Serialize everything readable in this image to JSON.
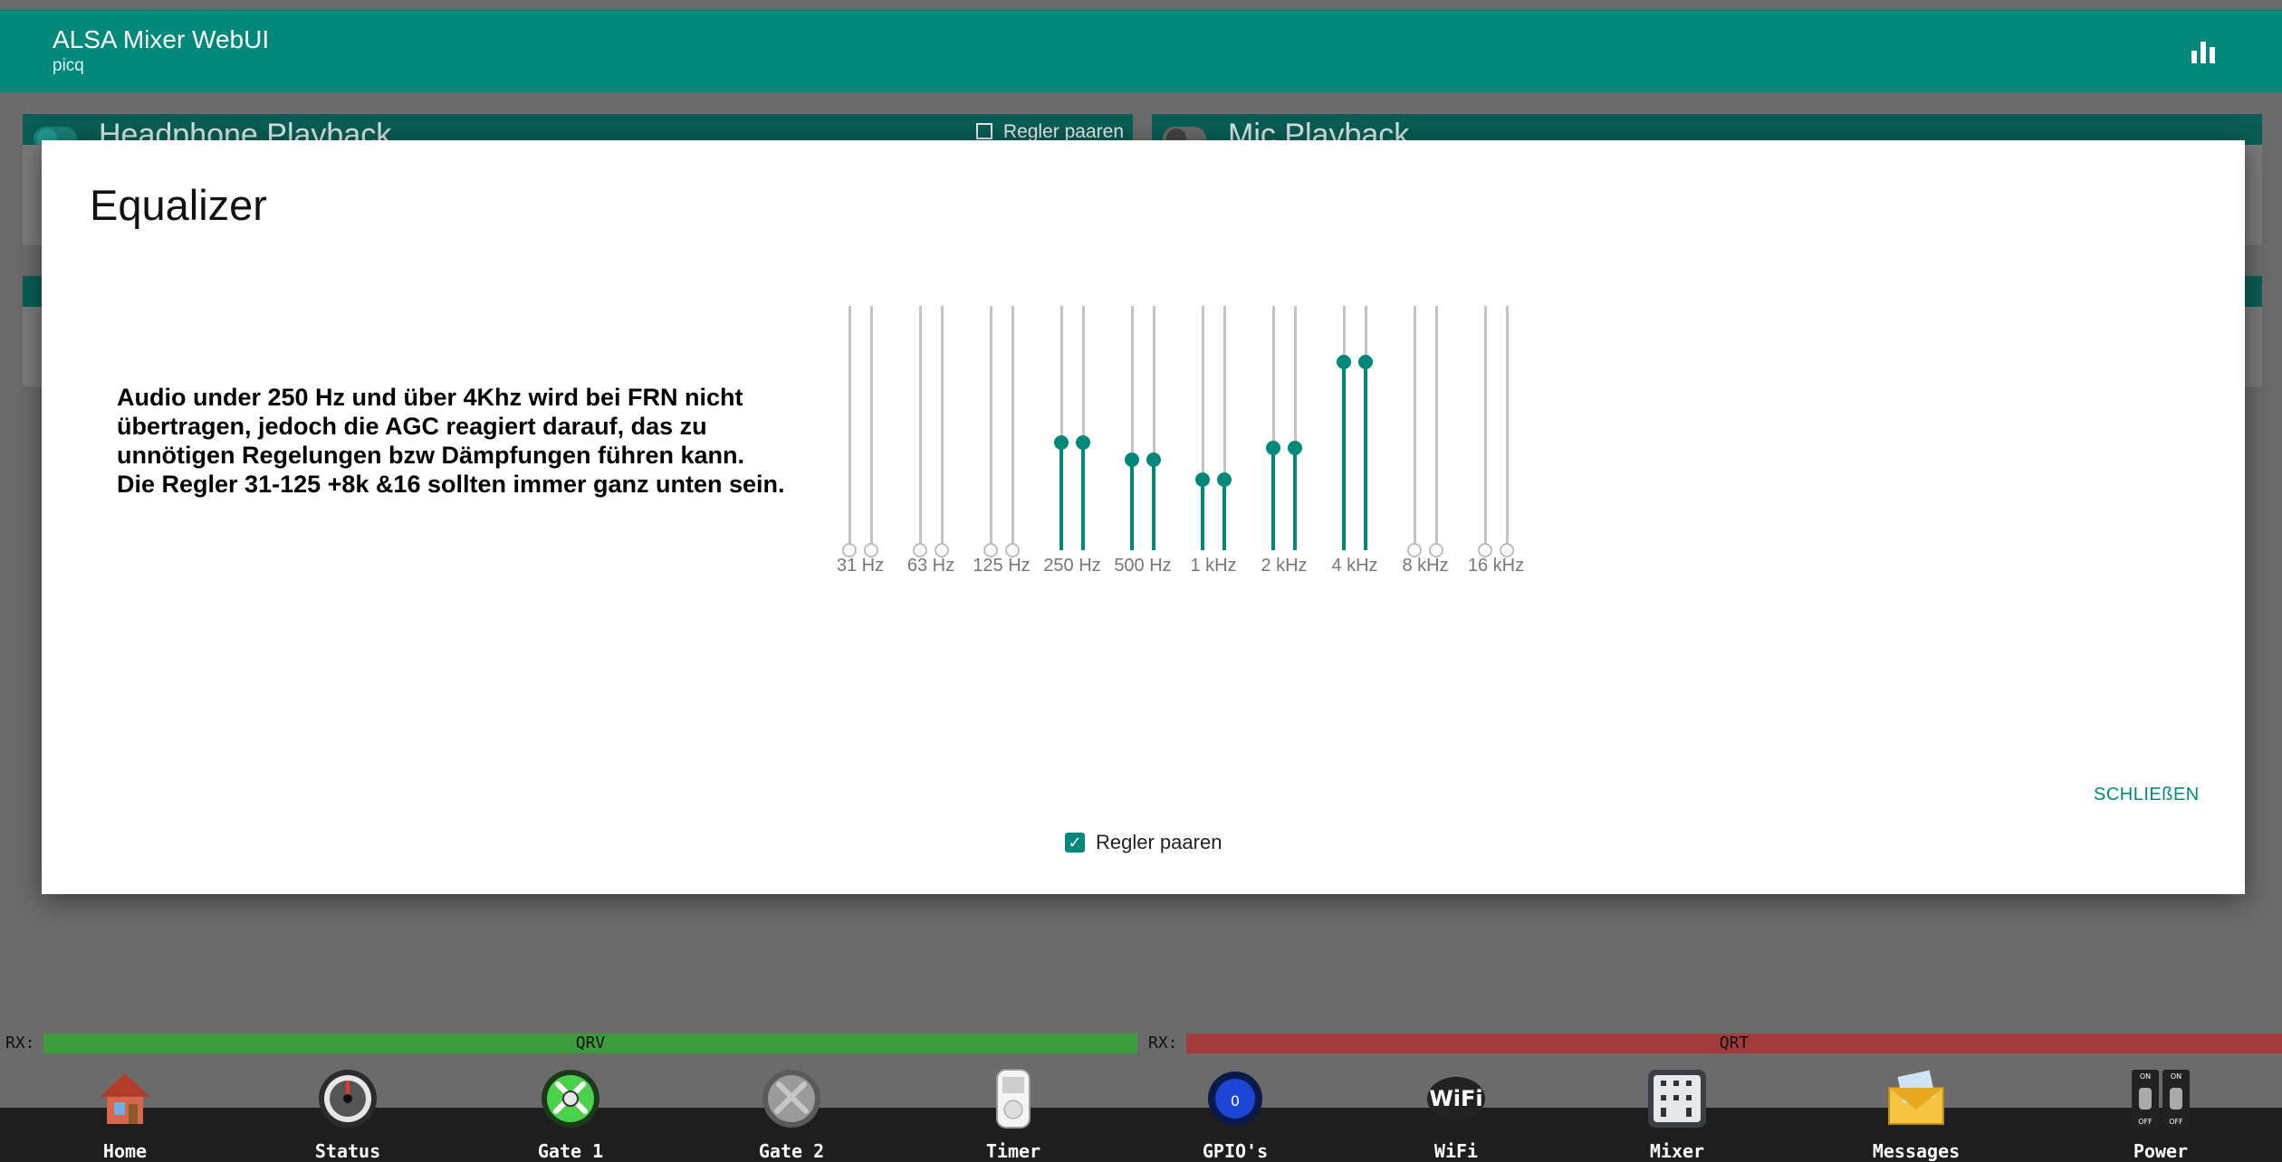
{
  "app": {
    "title": "ALSA Mixer WebUI",
    "subtitle": "picq"
  },
  "cards": {
    "left_title": "Headphone Playback",
    "left_pair_label": "Regler paaren",
    "right_title": "Mic Playback"
  },
  "modal": {
    "title": "Equalizer",
    "note": "Audio under 250 Hz und über 4Khz wird bei FRN nicht übertragen, jedoch die AGC reagiert darauf, das zu unnötigen Regelungen bzw Dämpfungen führen kann. Die Regler 31-125 +8k &16 sollten immer ganz unten sein.",
    "close_label": "SCHLIEßEN",
    "pair_label": "Regler paaren",
    "pair_checked": true
  },
  "equalizer": {
    "bands": [
      {
        "label": "31 Hz",
        "level": 0
      },
      {
        "label": "63 Hz",
        "level": 0
      },
      {
        "label": "125 Hz",
        "level": 0
      },
      {
        "label": "250 Hz",
        "level": 0.44
      },
      {
        "label": "500 Hz",
        "level": 0.37
      },
      {
        "label": "1 kHz",
        "level": 0.29
      },
      {
        "label": "2 kHz",
        "level": 0.42
      },
      {
        "label": "4 kHz",
        "level": 0.77
      },
      {
        "label": "8 kHz",
        "level": 0
      },
      {
        "label": "16 kHz",
        "level": 0
      }
    ],
    "accent": "#00897b"
  },
  "status": {
    "left_prefix": "RX:",
    "left_text": "QRV",
    "left_color": "#3c9b3c",
    "right_prefix": "RX:",
    "right_text": "QRT",
    "right_color": "#a23b3b"
  },
  "dock": [
    {
      "label": "Home",
      "icon": "house-icon"
    },
    {
      "label": "Status",
      "icon": "gauge-icon"
    },
    {
      "label": "Gate 1",
      "icon": "gate-active-icon"
    },
    {
      "label": "Gate 2",
      "icon": "gate-inactive-icon"
    },
    {
      "label": "Timer",
      "icon": "timer-socket-icon"
    },
    {
      "label": "GPIO's",
      "icon": "gpio-icon"
    },
    {
      "label": "WiFi",
      "icon": "wifi-icon"
    },
    {
      "label": "Mixer",
      "icon": "mixer-icon"
    },
    {
      "label": "Messages",
      "icon": "envelope-icon"
    },
    {
      "label": "Power",
      "icon": "power-switch-icon"
    }
  ]
}
